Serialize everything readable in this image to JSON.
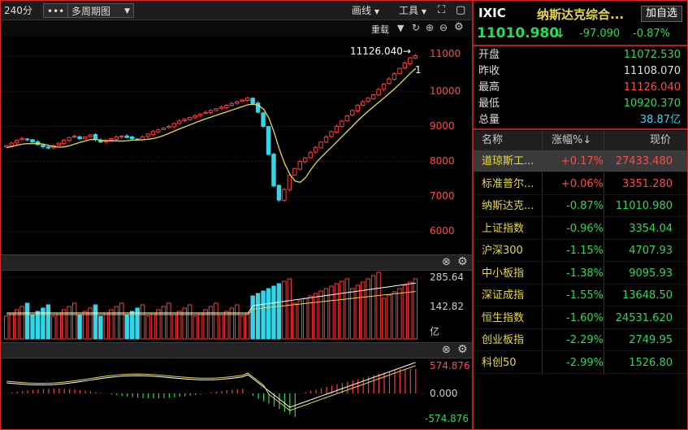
{
  "toolbar": {
    "period": "240分",
    "more": "•••",
    "multi_period": "多周期图",
    "draw": "画线",
    "tools": "工具"
  },
  "subbar": {
    "reset": "重载"
  },
  "main_chart": {
    "price_ticks": [
      "11000",
      "10000",
      "9000",
      "8000",
      "7000",
      "6000"
    ],
    "high_marker": "11126.040→",
    "marker_num": "1"
  },
  "volume_panel": {
    "ticks": [
      "285.64",
      "142.82",
      "亿"
    ]
  },
  "macd_panel": {
    "ticks": [
      "574.876",
      "0.000",
      "-574.876"
    ]
  },
  "quote": {
    "symbol": "IXIC",
    "name": "纳斯达克综合...",
    "watch_button": "加自选",
    "price": "11010.980",
    "arrow": "↓",
    "change": "-97.090",
    "change_pct": "-0.87%",
    "rows": [
      {
        "k": "开盘",
        "v": "11072.530",
        "color": "green"
      },
      {
        "k": "昨收",
        "v": "11108.070",
        "color": "white"
      },
      {
        "k": "最高",
        "v": "11126.040",
        "color": "red"
      },
      {
        "k": "最低",
        "v": "10920.370",
        "color": "green"
      },
      {
        "k": "总量",
        "v": "38.87亿",
        "color": "cyan"
      }
    ]
  },
  "table": {
    "headers": [
      "名称",
      "涨幅%↓",
      "现价"
    ],
    "rows": [
      {
        "name": "道琼斯工...",
        "pct": "+0.17%",
        "price": "27433.480",
        "color": "red"
      },
      {
        "name": "标准普尔...",
        "pct": "+0.06%",
        "price": "3351.280",
        "color": "red"
      },
      {
        "name": "纳斯达克...",
        "pct": "-0.87%",
        "price": "11010.980",
        "color": "green"
      },
      {
        "name": "上证指数",
        "pct": "-0.96%",
        "price": "3354.04",
        "color": "green"
      },
      {
        "name": "沪深300",
        "pct": "-1.15%",
        "price": "4707.93",
        "color": "green"
      },
      {
        "name": "中小板指",
        "pct": "-1.38%",
        "price": "9095.93",
        "color": "green"
      },
      {
        "name": "深证成指",
        "pct": "-1.55%",
        "price": "13648.50",
        "color": "green"
      },
      {
        "name": "恒生指数",
        "pct": "-1.60%",
        "price": "24531.620",
        "color": "green"
      },
      {
        "name": "创业板指",
        "pct": "-2.29%",
        "price": "2749.95",
        "color": "green"
      },
      {
        "name": "科创50",
        "pct": "-2.99%",
        "price": "1526.80",
        "color": "green"
      }
    ]
  },
  "chart_data": {
    "type": "candlestick",
    "price_axis": {
      "min": 6000,
      "max": 11000,
      "ticks": [
        11000,
        10000,
        9000,
        8000,
        7000,
        6000
      ]
    },
    "close": [
      8450,
      8520,
      8600,
      8650,
      8620,
      8550,
      8480,
      8420,
      8380,
      8450,
      8520,
      8600,
      8680,
      8720,
      8650,
      8700,
      8750,
      8620,
      8550,
      8600,
      8650,
      8700,
      8720,
      8680,
      8650,
      8620,
      8700,
      8780,
      8850,
      8900,
      8950,
      9000,
      9080,
      9150,
      9200,
      9250,
      9300,
      9350,
      9400,
      9450,
      9500,
      9550,
      9600,
      9650,
      9700,
      9750,
      9800,
      9650,
      9400,
      9000,
      8200,
      7300,
      6900,
      7200,
      7600,
      7800,
      8000,
      8100,
      8250,
      8400,
      8550,
      8700,
      8850,
      9000,
      9150,
      9300,
      9450,
      9600,
      9700,
      9800,
      9900,
      10050,
      10200,
      10350,
      10500,
      10650,
      10800,
      10950,
      11010
    ]
  }
}
